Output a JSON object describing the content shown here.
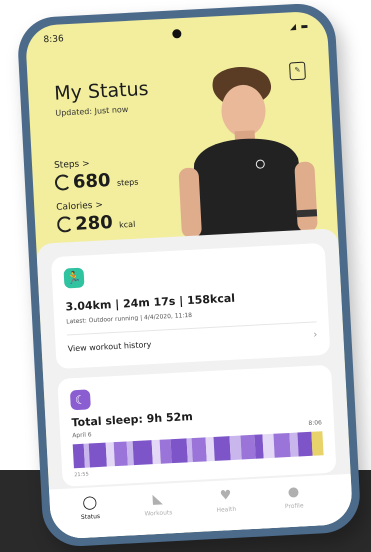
{
  "status_bar": {
    "time": "8:36",
    "icons": "◢ ▬"
  },
  "header": {
    "title": "My Status",
    "subtitle": "Updated: Just now",
    "badge_icon": "edit-icon",
    "badge_glyph": "✎"
  },
  "metrics": {
    "steps": {
      "label": "Steps >",
      "value": "680",
      "unit": "steps"
    },
    "calories": {
      "label": "Calories >",
      "value": "280",
      "unit": "kcal"
    }
  },
  "workout": {
    "icon": "running-icon",
    "icon_glyph": "🏃",
    "icon_color": "#2fc3a0",
    "stats": "3.04km | 24m 17s | 158kcal",
    "latest": "Latest: Outdoor running | 4/4/2020, 11:18",
    "history_label": "View workout history",
    "arrow": "›"
  },
  "sleep": {
    "icon": "moon-icon",
    "icon_glyph": "☾",
    "icon_color": "#8a5ed1",
    "title": "Total sleep: 9h 52m",
    "date": "April 6",
    "end_time": "8:06",
    "start_time": "21:55",
    "segments": [
      {
        "w": 4,
        "c": "#7d55c8"
      },
      {
        "w": 2,
        "c": "#c9b6ec"
      },
      {
        "w": 6,
        "c": "#7d55c8"
      },
      {
        "w": 3,
        "c": "#e3d8f5"
      },
      {
        "w": 5,
        "c": "#9a74d8"
      },
      {
        "w": 2,
        "c": "#c9b6ec"
      },
      {
        "w": 7,
        "c": "#7d55c8"
      },
      {
        "w": 3,
        "c": "#e3d8f5"
      },
      {
        "w": 4,
        "c": "#9a74d8"
      },
      {
        "w": 6,
        "c": "#7d55c8"
      },
      {
        "w": 2,
        "c": "#c9b6ec"
      },
      {
        "w": 5,
        "c": "#9a74d8"
      },
      {
        "w": 3,
        "c": "#e3d8f5"
      },
      {
        "w": 6,
        "c": "#7d55c8"
      },
      {
        "w": 4,
        "c": "#c9b6ec"
      },
      {
        "w": 5,
        "c": "#9a74d8"
      },
      {
        "w": 3,
        "c": "#7d55c8"
      },
      {
        "w": 4,
        "c": "#e3d8f5"
      },
      {
        "w": 6,
        "c": "#9a74d8"
      },
      {
        "w": 3,
        "c": "#c9b6ec"
      },
      {
        "w": 5,
        "c": "#7d55c8"
      },
      {
        "w": 4,
        "c": "#e8d36a"
      }
    ]
  },
  "mini_cards": {
    "left": {
      "icon": "heart-icon",
      "icon_glyph": "♥",
      "icon_color": "#e0443e"
    },
    "right": {
      "icon": "person-icon",
      "icon_glyph": "⚲",
      "icon_color": "#3c8fe0"
    }
  },
  "nav": {
    "items": [
      {
        "label": "Status",
        "icon": "status-icon",
        "glyph": "◯"
      },
      {
        "label": "Workouts",
        "icon": "workouts-icon",
        "glyph": "◣"
      },
      {
        "label": "Health",
        "icon": "health-icon",
        "glyph": "♥"
      },
      {
        "label": "Profile",
        "icon": "profile-icon",
        "glyph": "●"
      }
    ]
  },
  "colors": {
    "status_bg": "#f2ee9e",
    "frame": "#4c6a8a",
    "panel": "#f1f1f1"
  }
}
